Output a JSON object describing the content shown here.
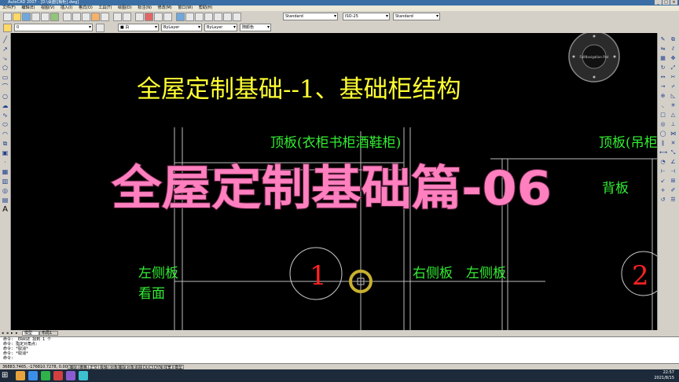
{
  "window": {
    "title": "AutoCAD 2007 - [D:\\桌面\\[橱柜].dwg]",
    "buttons": [
      "_",
      "□",
      "×"
    ]
  },
  "menu": [
    "文件(F)",
    "编辑(E)",
    "视图(V)",
    "插入(I)",
    "格式(O)",
    "工具(T)",
    "绘图(D)",
    "标注(N)",
    "修改(M)",
    "窗口(W)",
    "帮助(H)"
  ],
  "toolbar": {
    "layer": "0",
    "color": "■ 白",
    "linetype": "ByLayer",
    "lineweight": "ByLayer",
    "plotstyle": "随颜色",
    "textstyle": "Standard",
    "dimstyle": "ISO-25",
    "tablestyle": "Standard"
  },
  "drawing": {
    "title": "全屋定制基础--1、基础柜结构",
    "top_panel_left": "顶板(衣柜书柜酒鞋柜)",
    "top_panel_right": "顶板(吊柜...",
    "back_panel": "背板",
    "left_side": "左侧板",
    "view_label": "看面",
    "right_side": "右侧板",
    "left_side_2": "左侧板",
    "marker_1": "1",
    "marker_2": "2",
    "overlay_title": "全屋定制基础篇-06",
    "wheel_label": "FullNavigation Pad"
  },
  "tabs": {
    "model": "模型",
    "layout": "布局1"
  },
  "command_lines": [
    "命令: _ERASE 找到 1 个",
    "命令: 指定对角点:",
    "命令: *取消*",
    "命令: *取消*",
    "命令:"
  ],
  "status": {
    "coords": "36883.7465, -176810.7278, 0.0000",
    "modes": [
      "捕捉",
      "栅格",
      "正交",
      "极轴",
      "对象捕捉",
      "对象追踪",
      "DUCS",
      "DYN",
      "线宽",
      "模型"
    ]
  },
  "clock": {
    "time": "22:57",
    "date": "2021/8/15"
  },
  "colors": {
    "drawing_text": "#ffff33",
    "label_green": "#33ee33",
    "marker_red": "#ff2222",
    "overlay_pink": "#ff7fbf",
    "canvas": "#000000"
  }
}
